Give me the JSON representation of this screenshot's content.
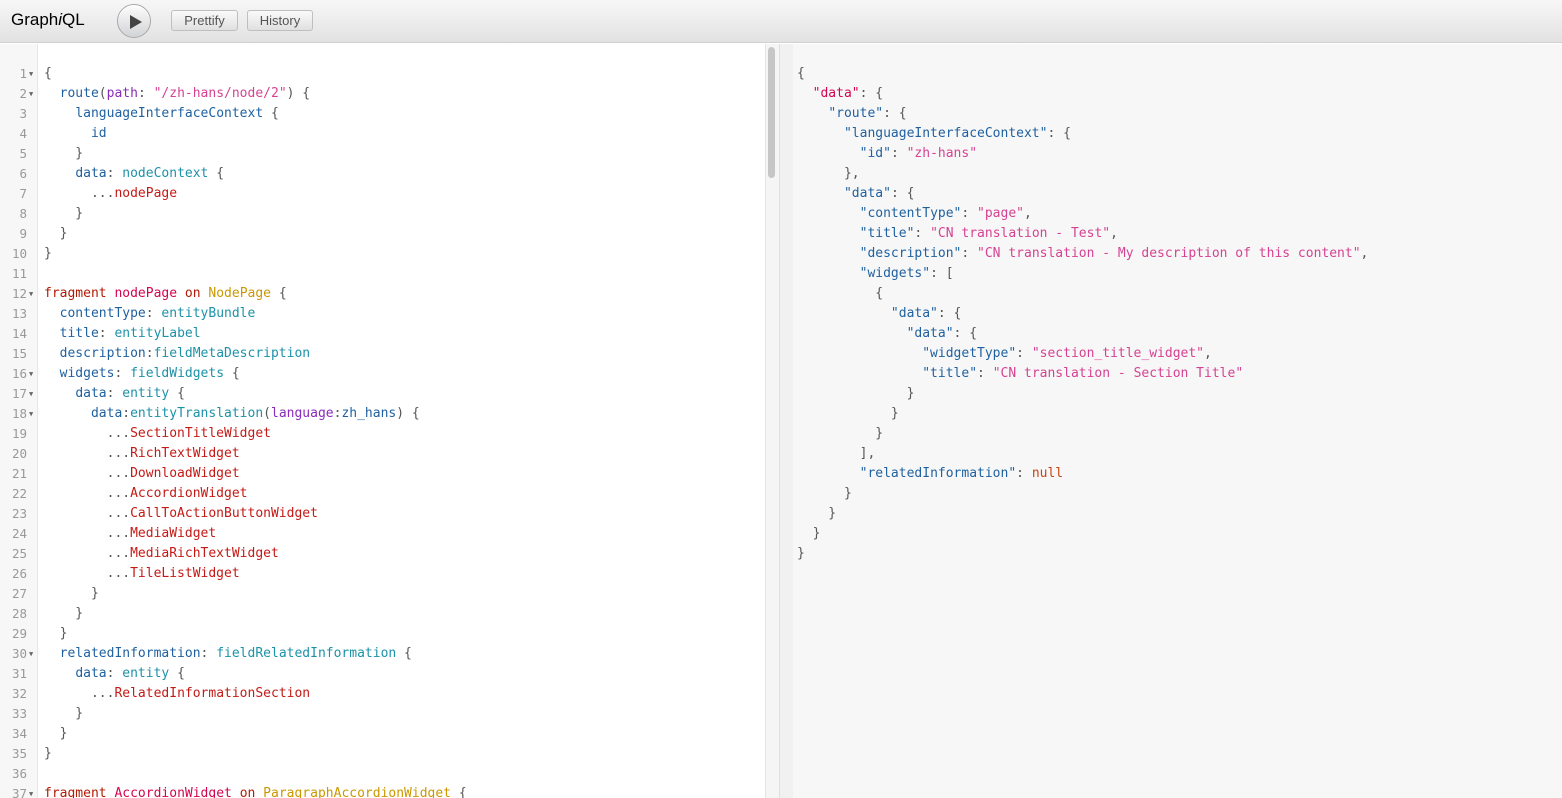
{
  "app": {
    "title_plain": "Graph",
    "title_italic": "i",
    "title_rest": "QL"
  },
  "toolbar": {
    "prettify_label": "Prettify",
    "history_label": "History"
  },
  "query_lines": [
    {
      "n": "1",
      "fold": true,
      "tokens": [
        [
          "pun",
          "{"
        ]
      ]
    },
    {
      "n": "2",
      "fold": true,
      "tokens": [
        [
          "pun",
          "  "
        ],
        [
          "prop",
          "route"
        ],
        [
          "pun",
          "("
        ],
        [
          "attr",
          "path"
        ],
        [
          "pun",
          ": "
        ],
        [
          "str",
          "\"/zh-hans/node/2\""
        ],
        [
          "pun",
          ") {"
        ]
      ]
    },
    {
      "n": "3",
      "fold": false,
      "tokens": [
        [
          "pun",
          "    "
        ],
        [
          "prop",
          "languageInterfaceContext"
        ],
        [
          "pun",
          " {"
        ]
      ]
    },
    {
      "n": "4",
      "fold": false,
      "tokens": [
        [
          "pun",
          "      "
        ],
        [
          "prop",
          "id"
        ]
      ]
    },
    {
      "n": "5",
      "fold": false,
      "tokens": [
        [
          "pun",
          "    }"
        ]
      ]
    },
    {
      "n": "6",
      "fold": false,
      "tokens": [
        [
          "pun",
          "    "
        ],
        [
          "prop",
          "data"
        ],
        [
          "pun",
          ": "
        ],
        [
          "qual",
          "nodeContext"
        ],
        [
          "pun",
          " {"
        ]
      ]
    },
    {
      "n": "7",
      "fold": false,
      "tokens": [
        [
          "pun",
          "      ..."
        ],
        [
          "frag",
          "nodePage"
        ]
      ]
    },
    {
      "n": "8",
      "fold": false,
      "tokens": [
        [
          "pun",
          "    }"
        ]
      ]
    },
    {
      "n": "9",
      "fold": false,
      "tokens": [
        [
          "pun",
          "  }"
        ]
      ]
    },
    {
      "n": "10",
      "fold": false,
      "tokens": [
        [
          "pun",
          "}"
        ]
      ]
    },
    {
      "n": "11",
      "fold": false,
      "tokens": []
    },
    {
      "n": "12",
      "fold": true,
      "tokens": [
        [
          "kw",
          "fragment"
        ],
        [
          "pun",
          " "
        ],
        [
          "def",
          "nodePage"
        ],
        [
          "pun",
          " "
        ],
        [
          "kw",
          "on"
        ],
        [
          "pun",
          " "
        ],
        [
          "type",
          "NodePage"
        ],
        [
          "pun",
          " {"
        ]
      ]
    },
    {
      "n": "13",
      "fold": false,
      "tokens": [
        [
          "pun",
          "  "
        ],
        [
          "prop",
          "contentType"
        ],
        [
          "pun",
          ": "
        ],
        [
          "qual",
          "entityBundle"
        ]
      ]
    },
    {
      "n": "14",
      "fold": false,
      "tokens": [
        [
          "pun",
          "  "
        ],
        [
          "prop",
          "title"
        ],
        [
          "pun",
          ": "
        ],
        [
          "qual",
          "entityLabel"
        ]
      ]
    },
    {
      "n": "15",
      "fold": false,
      "tokens": [
        [
          "pun",
          "  "
        ],
        [
          "prop",
          "description"
        ],
        [
          "pun",
          ":"
        ],
        [
          "qual",
          "fieldMetaDescription"
        ]
      ]
    },
    {
      "n": "16",
      "fold": true,
      "tokens": [
        [
          "pun",
          "  "
        ],
        [
          "prop",
          "widgets"
        ],
        [
          "pun",
          ": "
        ],
        [
          "qual",
          "fieldWidgets"
        ],
        [
          "pun",
          " {"
        ]
      ]
    },
    {
      "n": "17",
      "fold": true,
      "tokens": [
        [
          "pun",
          "    "
        ],
        [
          "prop",
          "data"
        ],
        [
          "pun",
          ": "
        ],
        [
          "qual",
          "entity"
        ],
        [
          "pun",
          " {"
        ]
      ]
    },
    {
      "n": "18",
      "fold": true,
      "tokens": [
        [
          "pun",
          "      "
        ],
        [
          "prop",
          "data"
        ],
        [
          "pun",
          ":"
        ],
        [
          "qual",
          "entityTranslation"
        ],
        [
          "pun",
          "("
        ],
        [
          "attr",
          "language"
        ],
        [
          "pun",
          ":"
        ],
        [
          "prop",
          "zh_hans"
        ],
        [
          "pun",
          ") {"
        ]
      ]
    },
    {
      "n": "19",
      "fold": false,
      "tokens": [
        [
          "pun",
          "        ..."
        ],
        [
          "frag",
          "SectionTitleWidget"
        ]
      ]
    },
    {
      "n": "20",
      "fold": false,
      "tokens": [
        [
          "pun",
          "        ..."
        ],
        [
          "frag",
          "RichTextWidget"
        ]
      ]
    },
    {
      "n": "21",
      "fold": false,
      "tokens": [
        [
          "pun",
          "        ..."
        ],
        [
          "frag",
          "DownloadWidget"
        ]
      ]
    },
    {
      "n": "22",
      "fold": false,
      "tokens": [
        [
          "pun",
          "        ..."
        ],
        [
          "frag",
          "AccordionWidget"
        ]
      ]
    },
    {
      "n": "23",
      "fold": false,
      "tokens": [
        [
          "pun",
          "        ..."
        ],
        [
          "frag",
          "CallToActionButtonWidget"
        ]
      ]
    },
    {
      "n": "24",
      "fold": false,
      "tokens": [
        [
          "pun",
          "        ..."
        ],
        [
          "frag",
          "MediaWidget"
        ]
      ]
    },
    {
      "n": "25",
      "fold": false,
      "tokens": [
        [
          "pun",
          "        ..."
        ],
        [
          "frag",
          "MediaRichTextWidget"
        ]
      ]
    },
    {
      "n": "26",
      "fold": false,
      "tokens": [
        [
          "pun",
          "        ..."
        ],
        [
          "frag",
          "TileListWidget"
        ]
      ]
    },
    {
      "n": "27",
      "fold": false,
      "tokens": [
        [
          "pun",
          "      }"
        ]
      ]
    },
    {
      "n": "28",
      "fold": false,
      "tokens": [
        [
          "pun",
          "    }"
        ]
      ]
    },
    {
      "n": "29",
      "fold": false,
      "tokens": [
        [
          "pun",
          "  }"
        ]
      ]
    },
    {
      "n": "30",
      "fold": true,
      "tokens": [
        [
          "pun",
          "  "
        ],
        [
          "prop",
          "relatedInformation"
        ],
        [
          "pun",
          ": "
        ],
        [
          "qual",
          "fieldRelatedInformation"
        ],
        [
          "pun",
          " {"
        ]
      ]
    },
    {
      "n": "31",
      "fold": false,
      "tokens": [
        [
          "pun",
          "    "
        ],
        [
          "prop",
          "data"
        ],
        [
          "pun",
          ": "
        ],
        [
          "qual",
          "entity"
        ],
        [
          "pun",
          " {"
        ]
      ]
    },
    {
      "n": "32",
      "fold": false,
      "tokens": [
        [
          "pun",
          "      ..."
        ],
        [
          "frag",
          "RelatedInformationSection"
        ]
      ]
    },
    {
      "n": "33",
      "fold": false,
      "tokens": [
        [
          "pun",
          "    }"
        ]
      ]
    },
    {
      "n": "34",
      "fold": false,
      "tokens": [
        [
          "pun",
          "  }"
        ]
      ]
    },
    {
      "n": "35",
      "fold": false,
      "tokens": [
        [
          "pun",
          "}"
        ]
      ]
    },
    {
      "n": "36",
      "fold": false,
      "tokens": []
    },
    {
      "n": "37",
      "fold": true,
      "tokens": [
        [
          "kw",
          "fragment"
        ],
        [
          "pun",
          " "
        ],
        [
          "def",
          "AccordionWidget"
        ],
        [
          "pun",
          " "
        ],
        [
          "kw",
          "on"
        ],
        [
          "pun",
          " "
        ],
        [
          "type",
          "ParagraphAccordionWidget"
        ],
        [
          "pun",
          " {"
        ]
      ]
    }
  ],
  "result_lines": [
    {
      "fold": true,
      "tokens": [
        [
          "pun",
          "{"
        ]
      ]
    },
    {
      "fold": true,
      "tokens": [
        [
          "pun",
          "  "
        ],
        [
          "def",
          "\"data\""
        ],
        [
          "pun",
          ": {"
        ]
      ]
    },
    {
      "fold": true,
      "tokens": [
        [
          "pun",
          "    "
        ],
        [
          "prop",
          "\"route\""
        ],
        [
          "pun",
          ": {"
        ]
      ]
    },
    {
      "fold": false,
      "tokens": [
        [
          "pun",
          "      "
        ],
        [
          "prop",
          "\"languageInterfaceContext\""
        ],
        [
          "pun",
          ": {"
        ]
      ]
    },
    {
      "fold": false,
      "tokens": [
        [
          "pun",
          "        "
        ],
        [
          "prop",
          "\"id\""
        ],
        [
          "pun",
          ": "
        ],
        [
          "str",
          "\"zh-hans\""
        ]
      ]
    },
    {
      "fold": false,
      "tokens": [
        [
          "pun",
          "      },"
        ]
      ]
    },
    {
      "fold": true,
      "tokens": [
        [
          "pun",
          "      "
        ],
        [
          "prop",
          "\"data\""
        ],
        [
          "pun",
          ": {"
        ]
      ]
    },
    {
      "fold": false,
      "tokens": [
        [
          "pun",
          "        "
        ],
        [
          "prop",
          "\"contentType\""
        ],
        [
          "pun",
          ": "
        ],
        [
          "str",
          "\"page\""
        ],
        [
          "pun",
          ","
        ]
      ]
    },
    {
      "fold": false,
      "tokens": [
        [
          "pun",
          "        "
        ],
        [
          "prop",
          "\"title\""
        ],
        [
          "pun",
          ": "
        ],
        [
          "str",
          "\"CN translation - Test\""
        ],
        [
          "pun",
          ","
        ]
      ]
    },
    {
      "fold": false,
      "tokens": [
        [
          "pun",
          "        "
        ],
        [
          "prop",
          "\"description\""
        ],
        [
          "pun",
          ": "
        ],
        [
          "str",
          "\"CN translation - My description of this content\""
        ],
        [
          "pun",
          ","
        ]
      ]
    },
    {
      "fold": true,
      "tokens": [
        [
          "pun",
          "        "
        ],
        [
          "prop",
          "\"widgets\""
        ],
        [
          "pun",
          ": ["
        ]
      ]
    },
    {
      "fold": true,
      "tokens": [
        [
          "pun",
          "          {"
        ]
      ]
    },
    {
      "fold": true,
      "tokens": [
        [
          "pun",
          "            "
        ],
        [
          "prop",
          "\"data\""
        ],
        [
          "pun",
          ": {"
        ]
      ]
    },
    {
      "fold": false,
      "tokens": [
        [
          "pun",
          "              "
        ],
        [
          "prop",
          "\"data\""
        ],
        [
          "pun",
          ": {"
        ]
      ]
    },
    {
      "fold": false,
      "tokens": [
        [
          "pun",
          "                "
        ],
        [
          "prop",
          "\"widgetType\""
        ],
        [
          "pun",
          ": "
        ],
        [
          "str",
          "\"section_title_widget\""
        ],
        [
          "pun",
          ","
        ]
      ]
    },
    {
      "fold": false,
      "tokens": [
        [
          "pun",
          "                "
        ],
        [
          "prop",
          "\"title\""
        ],
        [
          "pun",
          ": "
        ],
        [
          "str",
          "\"CN translation - Section Title\""
        ]
      ]
    },
    {
      "fold": false,
      "tokens": [
        [
          "pun",
          "              }"
        ]
      ]
    },
    {
      "fold": false,
      "tokens": [
        [
          "pun",
          "            }"
        ]
      ]
    },
    {
      "fold": false,
      "tokens": [
        [
          "pun",
          "          }"
        ]
      ]
    },
    {
      "fold": false,
      "tokens": [
        [
          "pun",
          "        ],"
        ]
      ]
    },
    {
      "fold": false,
      "tokens": [
        [
          "pun",
          "        "
        ],
        [
          "prop",
          "\"relatedInformation\""
        ],
        [
          "pun",
          ": "
        ],
        [
          "null",
          "null"
        ]
      ]
    },
    {
      "fold": false,
      "tokens": [
        [
          "pun",
          "      }"
        ]
      ]
    },
    {
      "fold": false,
      "tokens": [
        [
          "pun",
          "    }"
        ]
      ]
    },
    {
      "fold": false,
      "tokens": [
        [
          "pun",
          "  }"
        ]
      ]
    },
    {
      "fold": false,
      "tokens": [
        [
          "pun",
          "}"
        ]
      ]
    }
  ],
  "colors": {
    "keyword": "#b11a04",
    "definition": "#d2054e",
    "property": "#1f61a0",
    "qualifier": "#1c92a9",
    "attribute": "#8b2bb9",
    "string": "#d64292",
    "type": "#ca9800",
    "fragment": "#c41a16",
    "null": "#ca4212"
  }
}
